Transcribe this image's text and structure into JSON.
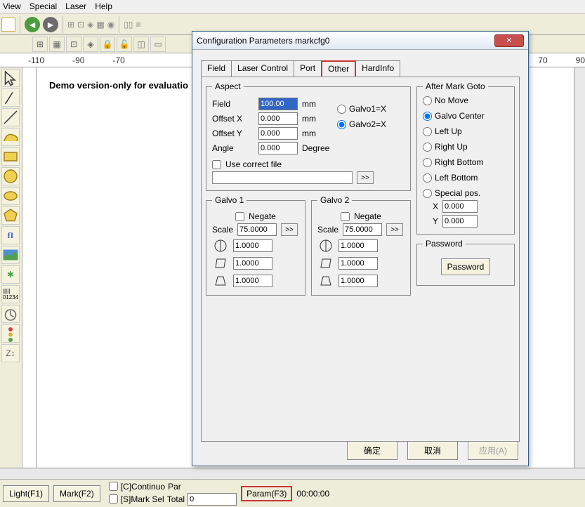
{
  "menu": {
    "view": "View",
    "special": "Special",
    "laser": "Laser",
    "help": "Help"
  },
  "ruler": [
    "-110",
    "-90",
    "-70",
    "70",
    "90"
  ],
  "canvas": {
    "demo": "Demo version-only for evaluatio"
  },
  "bottom": {
    "light": "Light(F1)",
    "mark": "Mark(F2)",
    "cont": "[C]Continuo",
    "par": "Par",
    "marksel": "[S]Mark Sel",
    "total": "Total",
    "totalval": "0",
    "param": "Param(F3)",
    "time": "00:00:00"
  },
  "dlg": {
    "title": "Configuration Parameters markcfg0",
    "tabs": {
      "field": "Field",
      "laser": "Laser Control",
      "port": "Port",
      "other": "Other",
      "hard": "HardInfo"
    },
    "aspect": {
      "legend": "Aspect",
      "field": "Field",
      "field_v": "100.00",
      "field_u": "mm",
      "ox": "Offset X",
      "ox_v": "0.000",
      "ox_u": "mm",
      "oy": "Offset Y",
      "oy_v": "0.000",
      "oy_u": "mm",
      "ang": "Angle",
      "ang_v": "0.000",
      "ang_u": "Degree",
      "g1": "Galvo1=X",
      "g2": "Galvo2=X",
      "usefile": "Use correct file"
    },
    "goto": {
      "legend": "After Mark Goto",
      "nomove": "No Move",
      "center": "Galvo Center",
      "lu": "Left Up",
      "ru": "Right Up",
      "rb": "Right Bottom",
      "lb": "Left Bottom",
      "sp": "Special pos.",
      "x": "X",
      "xv": "0.000",
      "y": "Y",
      "yv": "0.000"
    },
    "galvo1": {
      "legend": "Galvo 1",
      "neg": "Negate",
      "scale": "Scale",
      "scale_v": "75.0000",
      "v1": "1.0000",
      "v2": "1.0000",
      "v3": "1.0000"
    },
    "galvo2": {
      "legend": "Galvo 2",
      "neg": "Negate",
      "scale": "Scale",
      "scale_v": "75.0000",
      "v1": "1.0000",
      "v2": "1.0000",
      "v3": "1.0000"
    },
    "pwd": {
      "legend": "Password",
      "btn": "Password"
    },
    "btns": {
      "ok": "确定",
      "cancel": "取消",
      "apply": "应用(A)"
    }
  }
}
